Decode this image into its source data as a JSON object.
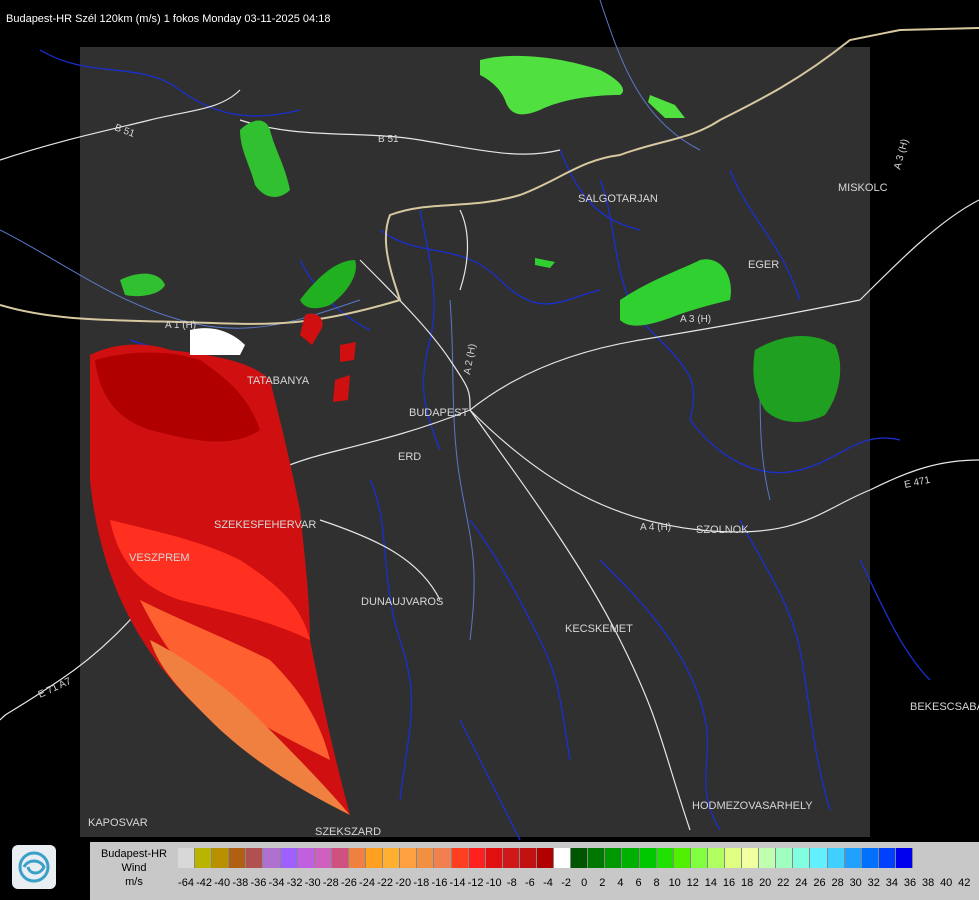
{
  "header": {
    "title": "Budapest-HR Szél 120km (m/s) 1 fokos Monday 03-11-2025 04:18"
  },
  "cities": [
    {
      "name": "SALGOTARJAN"
    },
    {
      "name": "MISKOLC"
    },
    {
      "name": "EGER"
    },
    {
      "name": "TATABANYA"
    },
    {
      "name": "BUDAPEST"
    },
    {
      "name": "ERD"
    },
    {
      "name": "SZEKESFEHERVAR"
    },
    {
      "name": "VESZPREM"
    },
    {
      "name": "DUNAUJVAROS"
    },
    {
      "name": "KECSKEMET"
    },
    {
      "name": "SZOLNOK"
    },
    {
      "name": "BEKESCSABA"
    },
    {
      "name": "HODMEZOVASARHELY"
    },
    {
      "name": "KAPOSVAR"
    },
    {
      "name": "SZEKSZARD"
    }
  ],
  "roads": [
    {
      "name": "B 51"
    },
    {
      "name": "B 51"
    },
    {
      "name": "A 3 (H)"
    },
    {
      "name": "A 3 (H)"
    },
    {
      "name": "A 2 (H)"
    },
    {
      "name": "A 4 (H)"
    },
    {
      "name": "E 471"
    },
    {
      "name": "E 71 A7"
    },
    {
      "name": "A 1 (H)"
    }
  ],
  "legend": {
    "line1": "Budapest-HR",
    "line2": "Wind",
    "line3": "m/s",
    "ticks": [
      "-64",
      "-42",
      "-40",
      "-38",
      "-36",
      "-34",
      "-32",
      "-30",
      "-28",
      "-26",
      "-24",
      "-22",
      "-20",
      "-18",
      "-16",
      "-14",
      "-12",
      "-10",
      "-8",
      "-6",
      "-4",
      "-2",
      "0",
      "2",
      "4",
      "6",
      "8",
      "10",
      "12",
      "14",
      "16",
      "18",
      "20",
      "22",
      "24",
      "26",
      "28",
      "30",
      "32",
      "34",
      "36",
      "38",
      "40",
      "42"
    ],
    "colors": [
      "#d8d8d8",
      "#b8b400",
      "#b89000",
      "#b06010",
      "#b05050",
      "#b070d0",
      "#a060ff",
      "#c060e0",
      "#d060c0",
      "#d05080",
      "#f08040",
      "#ffa020",
      "#ffb030",
      "#ffa040",
      "#f09040",
      "#f08050",
      "#ff4020",
      "#ff2020",
      "#e01010",
      "#d01818",
      "#c01010",
      "#b00000",
      "#ffffff",
      "#005500",
      "#007700",
      "#009900",
      "#00b000",
      "#00c800",
      "#20e000",
      "#50f000",
      "#80ff40",
      "#b0ff60",
      "#e0ff80",
      "#f0ffa0",
      "#c0ffb0",
      "#a0ffc0",
      "#80ffe0",
      "#60f0ff",
      "#40d0ff",
      "#20a0ff",
      "#0070ff",
      "#0040ff",
      "#0000ee"
    ]
  },
  "logo": {
    "icon": "omsz-logo-icon"
  }
}
